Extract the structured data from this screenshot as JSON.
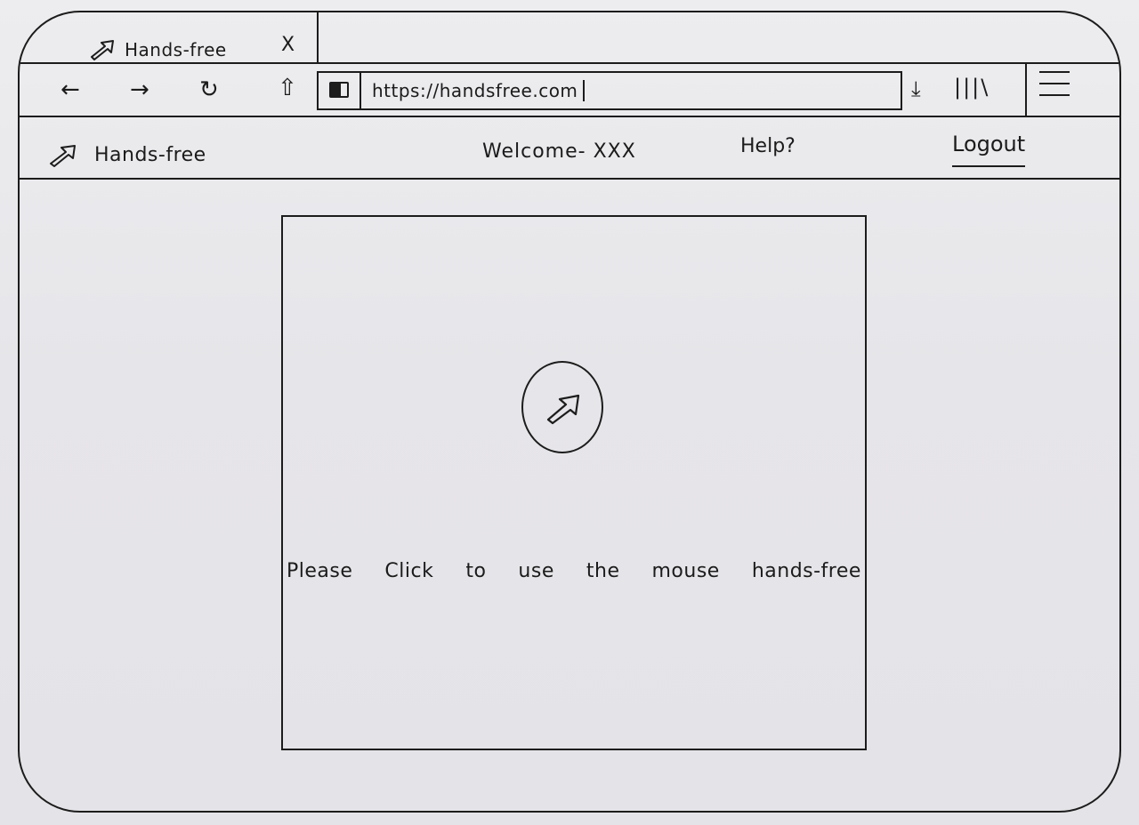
{
  "browser": {
    "tab": {
      "icon": "arrow-cursor-icon",
      "title": "Hands-free",
      "close_label": "X"
    },
    "nav": {
      "back": "←",
      "forward": "→",
      "reload": "↻",
      "home": "⇧",
      "url": "https://handsfree.com",
      "download": "⤓",
      "library": "|||\\"
    }
  },
  "app": {
    "logo_icon": "arrow-cursor-icon",
    "name": "Hands-free",
    "welcome": "Welcome- XXX",
    "help": "Help?",
    "logout": "Logout"
  },
  "main": {
    "button_icon": "arrow-cursor-icon",
    "instruction_words": [
      "Please",
      "Click",
      "to",
      "use",
      "the",
      "mouse",
      "hands-free"
    ]
  }
}
